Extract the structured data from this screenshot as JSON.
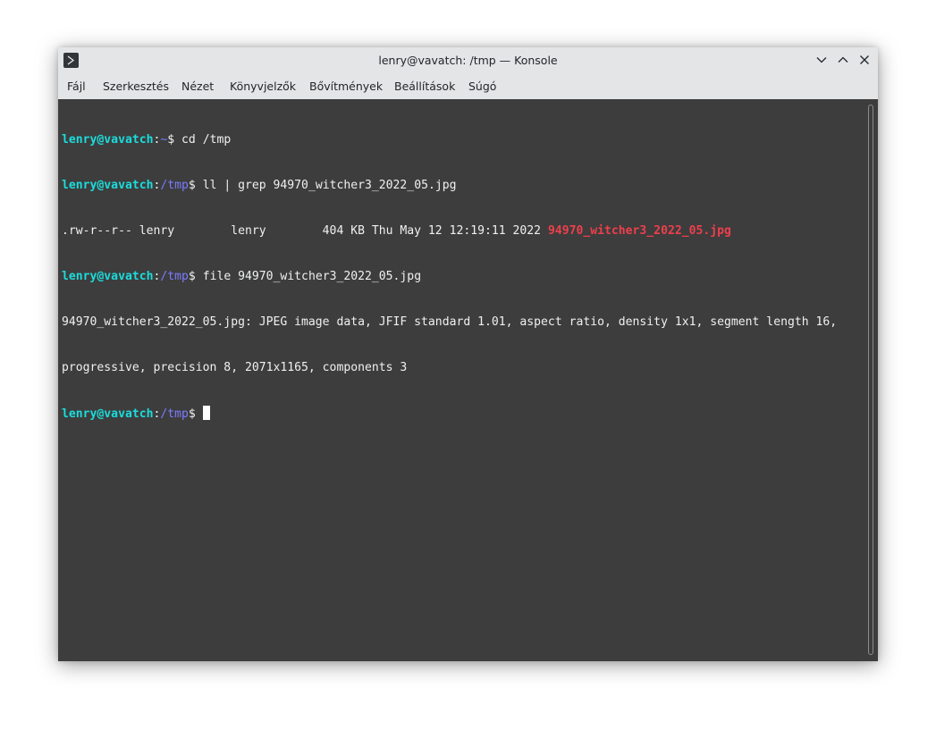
{
  "window": {
    "title": "lenry@vavatch: /tmp — Konsole",
    "icon": "konsole-app-icon",
    "controls": [
      "minimize-icon",
      "maximize-icon",
      "close-icon"
    ]
  },
  "menu": {
    "items": [
      "Fájl",
      "Szerkesztés",
      "Nézet",
      "Könyvjelzők",
      "Bővítmények",
      "Beállítások",
      "Súgó"
    ]
  },
  "terminal": {
    "lines": [
      {
        "user": "lenry@vavatch",
        "sep": ":",
        "path": "~",
        "prompt": "$",
        "cmd": " cd /tmp"
      },
      {
        "user": "lenry@vavatch",
        "sep": ":",
        "path": "/tmp",
        "prompt": "$",
        "cmd": " ll | grep 94970_witcher3_2022_05.jpg"
      },
      {
        "text": ".rw-r--r-- lenry        lenry        404 KB Thu May 12 12:19:11 2022 ",
        "match": "94970_witcher3_2022_05.jpg"
      },
      {
        "user": "lenry@vavatch",
        "sep": ":",
        "path": "/tmp",
        "prompt": "$",
        "cmd": " file 94970_witcher3_2022_05.jpg"
      },
      {
        "text": "94970_witcher3_2022_05.jpg: JPEG image data, JFIF standard 1.01, aspect ratio, density 1x1, segment length 16,"
      },
      {
        "text": "progressive, precision 8, 2071x1165, components 3"
      },
      {
        "user": "lenry@vavatch",
        "sep": ":",
        "path": "/tmp",
        "prompt": "$",
        "cmd": " "
      }
    ]
  },
  "colors": {
    "terminal_bg": "#3d3d3d",
    "terminal_fg": "#eff0f1",
    "prompt_user": "#1cdcdc",
    "prompt_path": "#7b7bff",
    "grep_match": "#ed3f4c",
    "chrome_bg": "#e3e5e7"
  }
}
